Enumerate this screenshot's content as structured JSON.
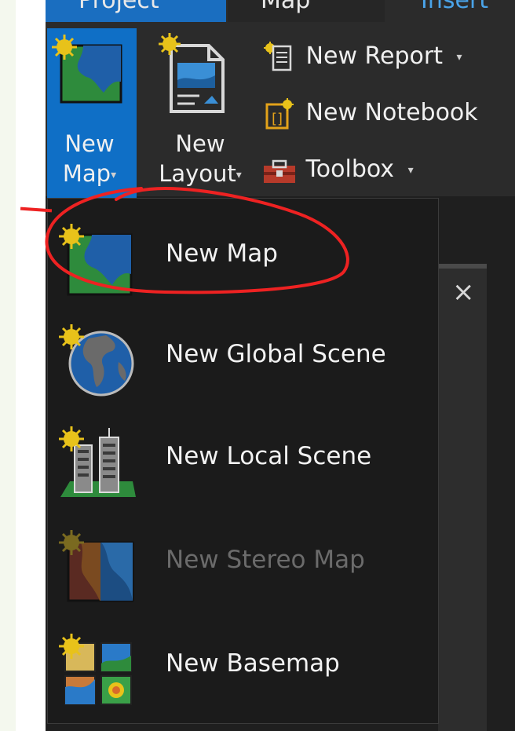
{
  "tabs": {
    "project": "Project",
    "map": "Map",
    "insert": "Insert"
  },
  "ribbon": {
    "new_map": {
      "line1": "New",
      "line2": "Map",
      "caret": "▾"
    },
    "new_layout": {
      "line1": "New",
      "line2": "Layout",
      "caret": "▾"
    },
    "new_report": {
      "label": "New Report",
      "caret": "▾"
    },
    "new_notebook": {
      "label": "New Notebook"
    },
    "toolbox": {
      "label": "Toolbox",
      "caret": "▾"
    }
  },
  "menu": {
    "items": [
      {
        "label": "New Map",
        "icon": "new-map-icon",
        "enabled": true,
        "highlighted": true
      },
      {
        "label": "New Global Scene",
        "icon": "globe-icon",
        "enabled": true
      },
      {
        "label": "New Local Scene",
        "icon": "buildings-icon",
        "enabled": true
      },
      {
        "label": "New Stereo Map",
        "icon": "stereo-map-icon",
        "enabled": false
      },
      {
        "label": "New Basemap",
        "icon": "basemap-icon",
        "enabled": true
      }
    ]
  },
  "pane": {
    "close_glyph": "×"
  },
  "colors": {
    "accent": "#0f6fc6",
    "annotation": "#ee2222",
    "menu_bg": "#1b1b1b",
    "disabled_text": "#6b6b6b"
  }
}
